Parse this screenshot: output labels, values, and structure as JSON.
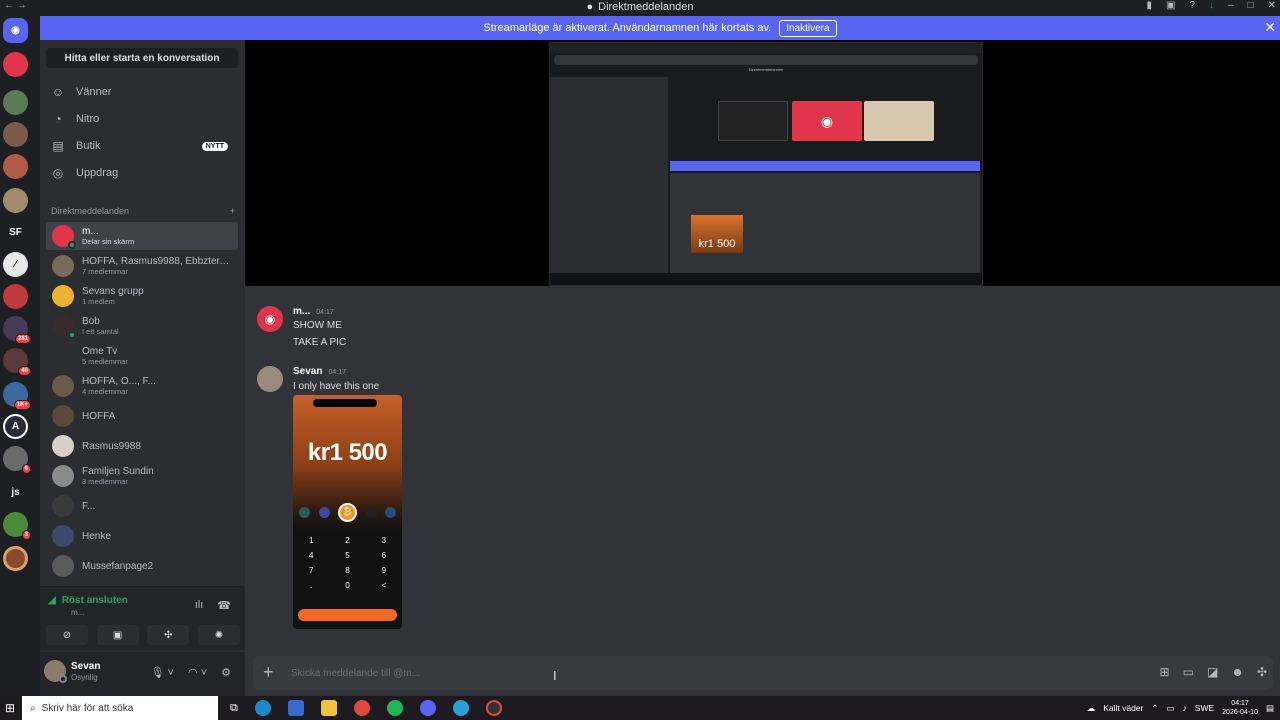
{
  "window": {
    "title": "Direktmeddelanden"
  },
  "banner": {
    "text": "Streamarläge är aktiverat. Användarnamnen här kortats av.",
    "button": "Inaktivera"
  },
  "sidebar": {
    "search": "Hitta eller starta en konversation",
    "nav": [
      {
        "label": "Vänner",
        "icon": "friends-icon"
      },
      {
        "label": "Nitro",
        "icon": "nitro-icon"
      },
      {
        "label": "Butik",
        "icon": "shop-icon",
        "badge": "NYTT"
      },
      {
        "label": "Uppdrag",
        "icon": "quests-icon"
      }
    ],
    "dm_header": "Direktmeddelanden",
    "dms": [
      {
        "name": "m...",
        "sub": "Delar sin skärm"
      },
      {
        "name": "HOFFA, Rasmus9988, Ebbzter, ...",
        "sub": "7 medlemmar"
      },
      {
        "name": "Sevans grupp",
        "sub": "1 medlem"
      },
      {
        "name": "Bob",
        "sub": "I ett samtal"
      },
      {
        "name": "Ome Tv",
        "sub": "5 medlemmar"
      },
      {
        "name": "HOFFA, O..., F...",
        "sub": "4 medlemmar"
      },
      {
        "name": "HOFFA",
        "sub": ""
      },
      {
        "name": "Rasmus9988",
        "sub": ""
      },
      {
        "name": "Familjen Sundin",
        "sub": "3 medlemmar"
      },
      {
        "name": "F...",
        "sub": ""
      },
      {
        "name": "Henke",
        "sub": ""
      },
      {
        "name": "Mussefanpage2",
        "sub": ""
      }
    ]
  },
  "servers": [
    {
      "label": "",
      "badge": ""
    },
    {
      "label": "",
      "badge": ""
    },
    {
      "label": "",
      "badge": ""
    },
    {
      "label": "",
      "badge": ""
    },
    {
      "label": "",
      "badge": ""
    },
    {
      "label": "",
      "badge": ""
    },
    {
      "label": "SF",
      "badge": ""
    },
    {
      "label": "",
      "badge": ""
    },
    {
      "label": "",
      "badge": ""
    },
    {
      "label": "",
      "badge": "281"
    },
    {
      "label": "",
      "badge": "46"
    },
    {
      "label": "",
      "badge": "1K+"
    },
    {
      "label": "",
      "badge": ""
    },
    {
      "label": "",
      "badge": "6"
    },
    {
      "label": "js",
      "badge": ""
    },
    {
      "label": "",
      "badge": "3"
    },
    {
      "label": "",
      "badge": ""
    }
  ],
  "voice": {
    "status": "Röst ansluten",
    "channel": "m..."
  },
  "user": {
    "name": "Sevan",
    "status": "Osynlig"
  },
  "messages": [
    {
      "author": "m...",
      "time": "04:17",
      "lines": [
        "SHOW ME",
        "TAKE A PIC"
      ]
    },
    {
      "author": "Sevan",
      "time": "04:17",
      "lines": [
        "I only have this one"
      ]
    }
  ],
  "attachment": {
    "amount": "kr1 500",
    "keypad": [
      "1",
      "2",
      "3",
      "4",
      "5",
      "6",
      "7",
      "8",
      "9",
      ".",
      "0",
      "<"
    ]
  },
  "stream_preview": {
    "amount": "kr1 500"
  },
  "composer": {
    "placeholder": "Skicka meddelande till @m..."
  },
  "taskbar": {
    "search_placeholder": "Skriv här för att söka",
    "weather": "Kallt väder",
    "lang": "SWE",
    "time": "04:17",
    "date": "2026-04-10"
  },
  "colors": {
    "blurple": "#5865f2",
    "online": "#23a55a",
    "bitcoin": "#f7931a"
  }
}
